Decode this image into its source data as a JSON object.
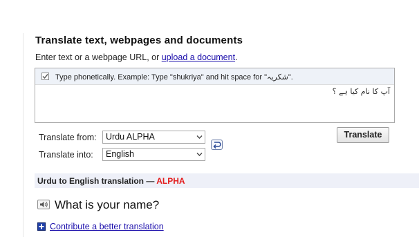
{
  "header": {
    "title": "Translate text, webpages and documents",
    "subtitle_prefix": "Enter text or a webpage URL, or ",
    "upload_link": "upload a document",
    "subtitle_suffix": "."
  },
  "input": {
    "phonetic_checked": true,
    "phonetic_text": "Type phonetically. Example: Type \"shukriya\" and hit space for \"شکریہ\".",
    "source_text": "آپ کا نام کیا ہے ؟"
  },
  "controls": {
    "from_label": "Translate from:",
    "from_value": "Urdu ALPHA",
    "into_label": "Translate into:",
    "into_value": "English",
    "translate_button": "Translate",
    "swap_icon": "swap-icon"
  },
  "result": {
    "heading_prefix": "Urdu to English translation — ",
    "heading_alpha": "ALPHA",
    "translation": "What is your name?",
    "contribute_link": "Contribute a better translation"
  },
  "colors": {
    "link": "#1a0dab",
    "alpha": "#e31b1b",
    "result_bar": "#eef0f8",
    "phonetic_bar": "#eef2f8"
  }
}
